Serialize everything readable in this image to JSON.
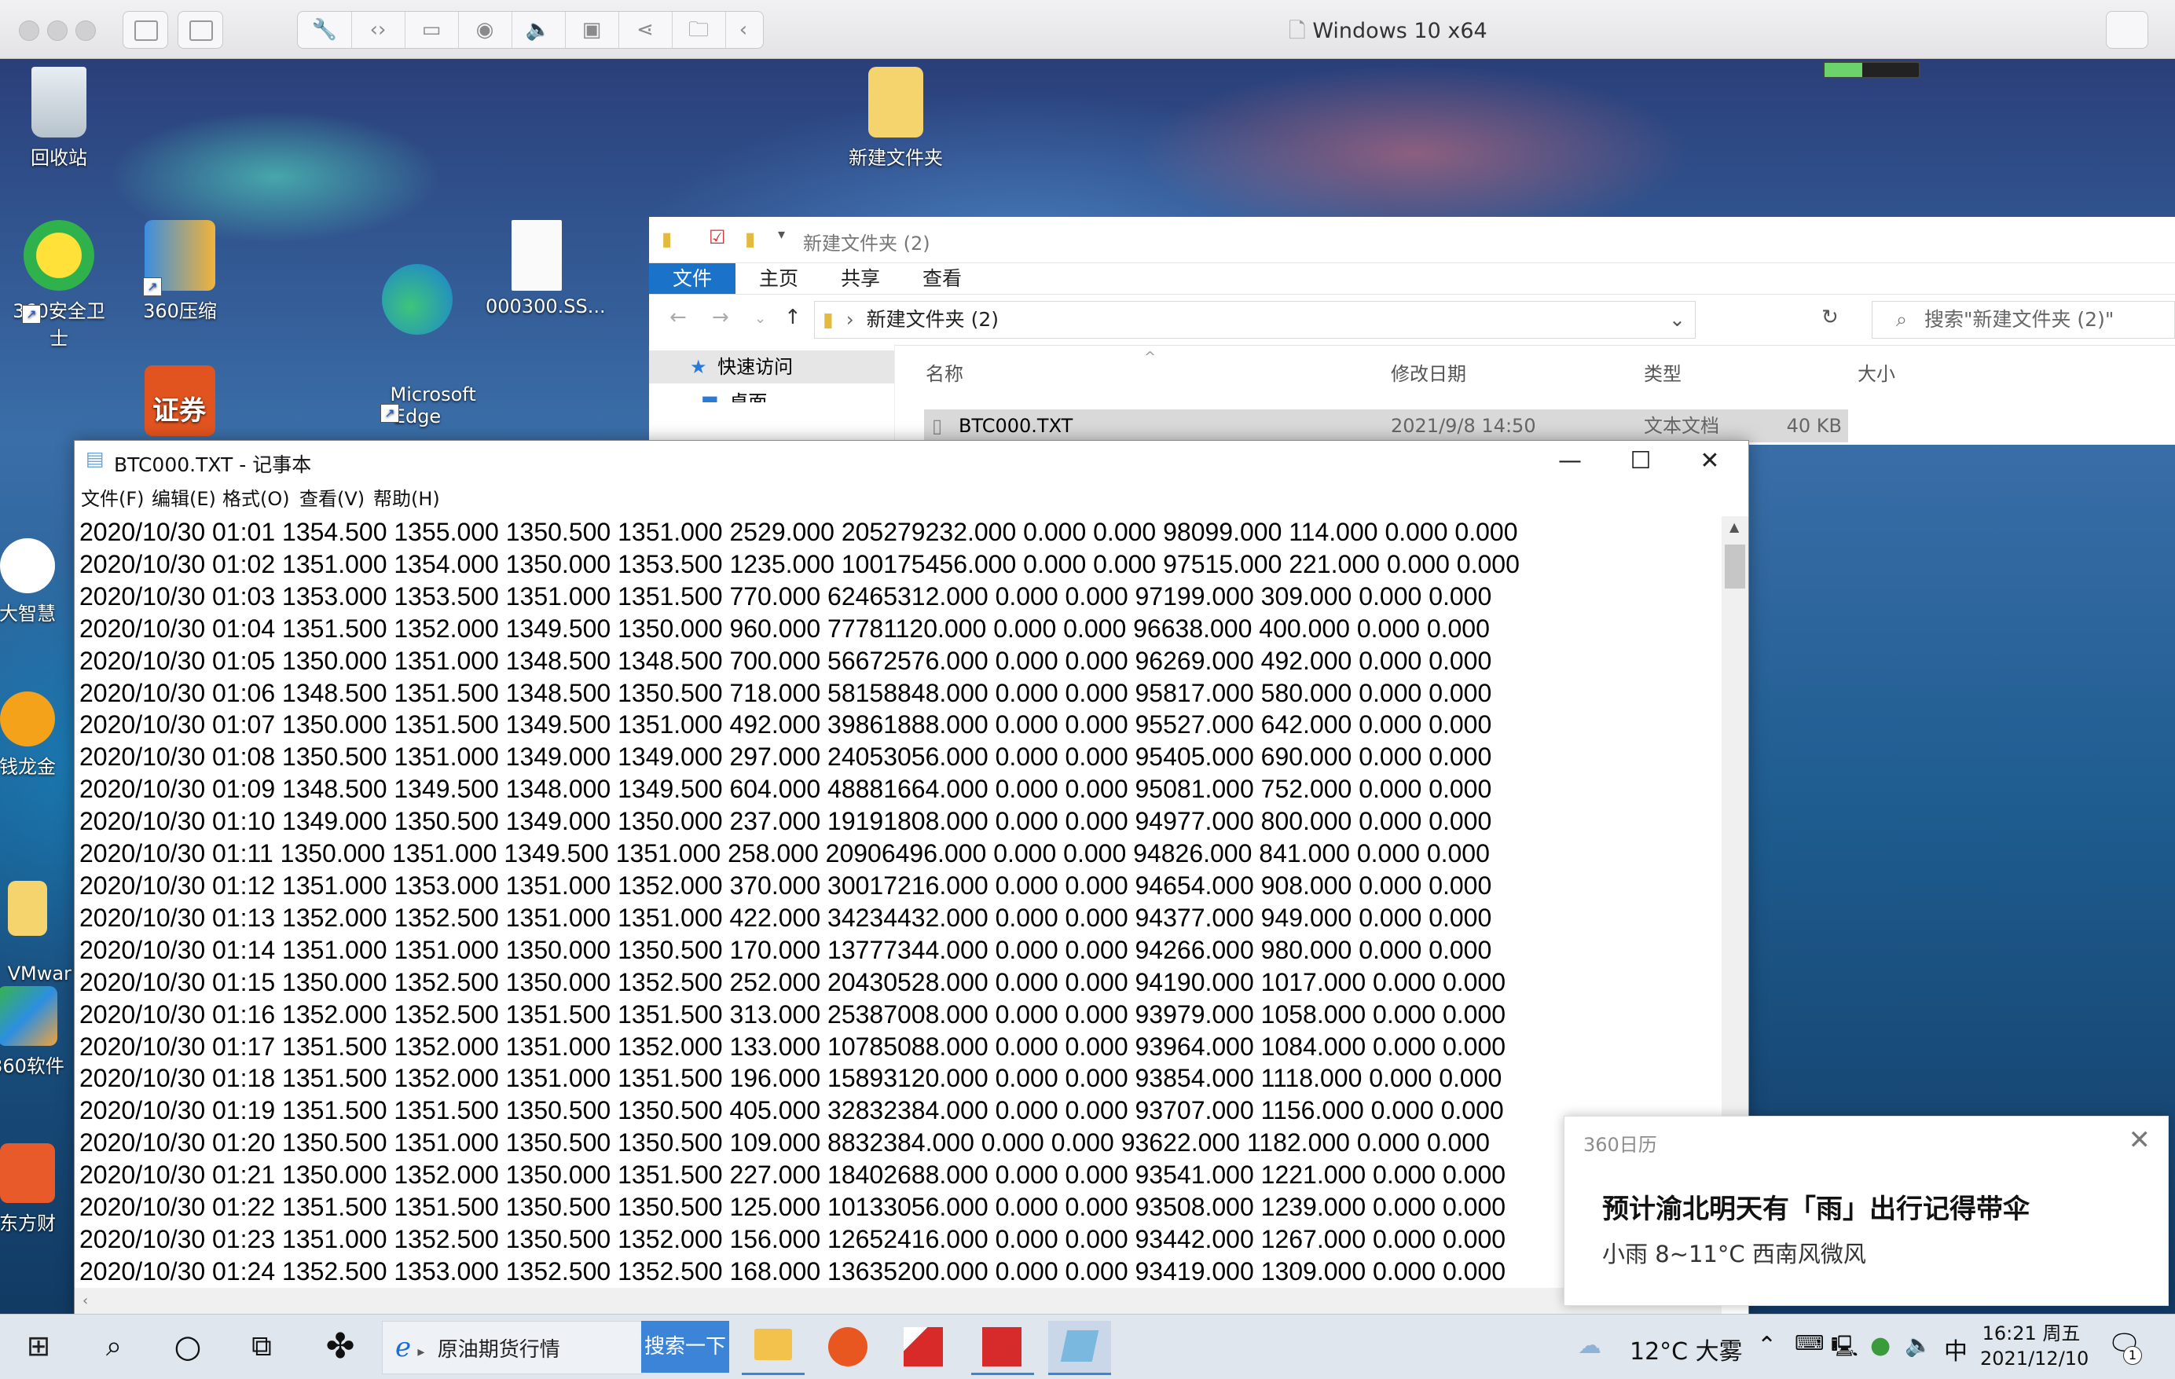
{
  "mac_window": {
    "title": "Windows 10 x64",
    "toolbar_icons": [
      "wrench-icon",
      "code-icon",
      "drive-icon",
      "camera-icon",
      "speaker-icon",
      "video-icon",
      "usb-icon",
      "folder-share-icon",
      "chevron-left-icon"
    ]
  },
  "desktop_icons": [
    {
      "label": "回收站"
    },
    {
      "label": "新建文件夹"
    },
    {
      "label": "360安全卫士"
    },
    {
      "label": "360压缩"
    },
    {
      "label": "Microsoft\nEdge"
    },
    {
      "label": "000300.SS..."
    },
    {
      "label": "大智慧"
    },
    {
      "label": "钱龙金"
    },
    {
      "label": "VMwar\n享文件"
    },
    {
      "label": "360软件"
    },
    {
      "label": "东方财"
    },
    {
      "label": "证券"
    }
  ],
  "explorer": {
    "title": "新建文件夹 (2)",
    "tabs": [
      "文件",
      "主页",
      "共享",
      "查看"
    ],
    "path": "新建文件夹 (2)",
    "search_placeholder": "搜索\"新建文件夹 (2)\"",
    "nav_quick": "快速访问",
    "nav_desktop": "桌面",
    "columns": {
      "name": "名称",
      "modified": "修改日期",
      "type": "类型",
      "size": "大小"
    },
    "file": {
      "name": "BTC000.TXT",
      "modified": "2021/9/8 14:50",
      "type": "文本文档",
      "size": "40 KB"
    }
  },
  "notepad": {
    "title": "BTC000.TXT - 记事本",
    "menu": [
      "文件(F)",
      "编辑(E)",
      "格式(O)",
      "查看(V)",
      "帮助(H)"
    ],
    "lines": [
      "2020/10/30 01:01 1354.500 1355.000 1350.500 1351.000 2529.000 205279232.000 0.000 0.000 98099.000 114.000 0.000 0.000",
      "2020/10/30 01:02 1351.000 1354.000 1350.000 1353.500 1235.000 100175456.000 0.000 0.000 97515.000 221.000 0.000 0.000",
      "2020/10/30 01:03 1353.000 1353.500 1351.000 1351.500 770.000 62465312.000 0.000 0.000 97199.000 309.000 0.000 0.000",
      "2020/10/30 01:04 1351.500 1352.000 1349.500 1350.000 960.000 77781120.000 0.000 0.000 96638.000 400.000 0.000 0.000",
      "2020/10/30 01:05 1350.000 1351.000 1348.500 1348.500 700.000 56672576.000 0.000 0.000 96269.000 492.000 0.000 0.000",
      "2020/10/30 01:06 1348.500 1351.500 1348.500 1350.500 718.000 58158848.000 0.000 0.000 95817.000 580.000 0.000 0.000",
      "2020/10/30 01:07 1350.000 1351.500 1349.500 1351.000 492.000 39861888.000 0.000 0.000 95527.000 642.000 0.000 0.000",
      "2020/10/30 01:08 1350.500 1351.000 1349.000 1349.000 297.000 24053056.000 0.000 0.000 95405.000 690.000 0.000 0.000",
      "2020/10/30 01:09 1348.500 1349.500 1348.000 1349.500 604.000 48881664.000 0.000 0.000 95081.000 752.000 0.000 0.000",
      "2020/10/30 01:10 1349.000 1350.500 1349.000 1350.000 237.000 19191808.000 0.000 0.000 94977.000 800.000 0.000 0.000",
      "2020/10/30 01:11 1350.000 1351.000 1349.500 1351.000 258.000 20906496.000 0.000 0.000 94826.000 841.000 0.000 0.000",
      "2020/10/30 01:12 1351.000 1353.000 1351.000 1352.000 370.000 30017216.000 0.000 0.000 94654.000 908.000 0.000 0.000",
      "2020/10/30 01:13 1352.000 1352.500 1351.000 1351.000 422.000 34234432.000 0.000 0.000 94377.000 949.000 0.000 0.000",
      "2020/10/30 01:14 1351.000 1351.000 1350.000 1350.500 170.000 13777344.000 0.000 0.000 94266.000 980.000 0.000 0.000",
      "2020/10/30 01:15 1350.000 1352.500 1350.000 1352.500 252.000 20430528.000 0.000 0.000 94190.000 1017.000 0.000 0.000",
      "2020/10/30 01:16 1352.000 1352.500 1351.500 1351.500 313.000 25387008.000 0.000 0.000 93979.000 1058.000 0.000 0.000",
      "2020/10/30 01:17 1351.500 1352.000 1351.000 1352.000 133.000 10785088.000 0.000 0.000 93964.000 1084.000 0.000 0.000",
      "2020/10/30 01:18 1351.500 1352.000 1351.000 1351.500 196.000 15893120.000 0.000 0.000 93854.000 1118.000 0.000 0.000",
      "2020/10/30 01:19 1351.500 1351.500 1350.500 1350.500 405.000 32832384.000 0.000 0.000 93707.000 1156.000 0.000 0.000",
      "2020/10/30 01:20 1350.500 1351.000 1350.500 1350.500 109.000 8832384.000 0.000 0.000 93622.000 1182.000 0.000 0.000",
      "2020/10/30 01:21 1350.000 1352.000 1350.000 1351.500 227.000 18402688.000 0.000 0.000 93541.000 1221.000 0.000 0.000",
      "2020/10/30 01:22 1351.500 1351.500 1350.500 1350.500 125.000 10133056.000 0.000 0.000 93508.000 1239.000 0.000 0.000",
      "2020/10/30 01:23 1351.000 1352.500 1350.500 1352.000 156.000 12652416.000 0.000 0.000 93442.000 1267.000 0.000 0.000",
      "2020/10/30 01:24 1352.500 1353.000 1352.500 1352.500 168.000 13635200.000 0.000 0.000 93419.000 1309.000 0.000 0.000"
    ]
  },
  "popup": {
    "source": "360日历",
    "headline": "预计渝北明天有「雨」出行记得带伞",
    "detail": "小雨 8~11°C 西南风微风"
  },
  "taskbar": {
    "search_text": "原油期货行情",
    "search_button": "搜索一下",
    "weather": "12°C 大雾",
    "ime": "中",
    "time": "16:21 周五",
    "date": "2021/12/10",
    "notification_count": "1"
  }
}
